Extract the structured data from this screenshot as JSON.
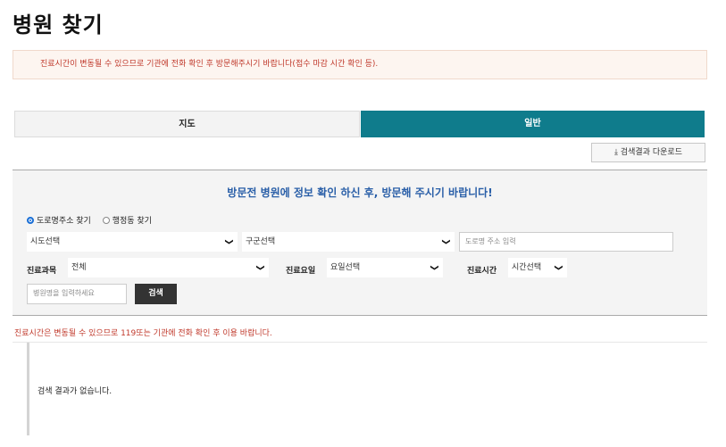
{
  "page": {
    "title": "병원 찾기",
    "notice": "진료시간이 변동될 수 있으므로 기관에 전화 확인 후 방문해주시기 바랍니다(접수 마감 시간 확인 등)."
  },
  "tabs": [
    {
      "label": "지도"
    },
    {
      "label": "일반"
    }
  ],
  "download": {
    "icon": "download-icon",
    "label": "검색결과 다운로드"
  },
  "search": {
    "headline": "방문전 병원에 정보 확인 하신 후, 방문해 주시기 바랍니다!",
    "radio_road": "도로명주소 찾기",
    "radio_dong": "행정동 찾기",
    "sido": "시도선택",
    "gugun": "구군선택",
    "road_placeholder": "도로명 주소 입력",
    "dept_label": "진료과목",
    "dept_value": "전체",
    "day_label": "진료요일",
    "day_value": "요일선택",
    "time_label": "진료시간",
    "time_value": "시간선택",
    "name_placeholder": "병원명을 입력하세요",
    "search_button": "검색"
  },
  "warning": "진료시간은 변동될 수 있으므로 119또는 기관에 전화 확인 후 이용 바랍니다.",
  "result": {
    "empty": "검색 결과가 없습니다."
  },
  "colors": {
    "accent": "#0f7c8c",
    "headline": "#2a5fa8",
    "warning": "#c0392b"
  }
}
